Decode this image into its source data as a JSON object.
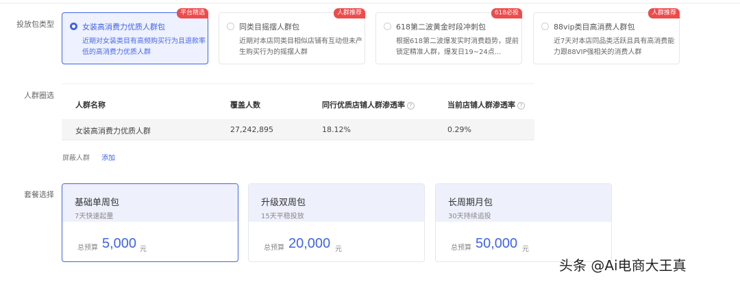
{
  "labels": {
    "package_type": "投放包类型",
    "crowd_select": "人群圈选",
    "plan_select": "套餐选择"
  },
  "packages": [
    {
      "title": "女装高消费力优质人群包",
      "tag": "平台精选",
      "desc": "近期对女装类目有高频购买行为且退款率低的高消费力优质人群"
    },
    {
      "title": "同类目摇摆人群包",
      "tag": "人群推荐",
      "desc": "近期对本店同类目相似店铺有互动但未产生购买行为的摇摆人群"
    },
    {
      "title": "618第二波黄金时段冲刺包",
      "tag": "618必投",
      "desc": "根据618第二波爆发实时消费趋势，提前锁定精准人群，爆发日19~24点..."
    },
    {
      "title": "88vip类目高消费人群包",
      "tag": "人群推荐",
      "desc": "近7天对本店同品类活跃且具有高消费能力跟88VIP强相关的消费人群"
    }
  ],
  "table": {
    "headers": [
      "人群名称",
      "覆盖人数",
      "同行优质店铺人群渗透率",
      "当前店铺人群渗透率"
    ],
    "row": [
      "女装高消费力优质人群",
      "27,242,895",
      "18.12%",
      "0.29%"
    ],
    "help_glyph": "?"
  },
  "shield": {
    "label": "屏蔽人群",
    "add": "添加"
  },
  "plans": [
    {
      "name": "基础单周包",
      "sub": "7天快速起量",
      "budget_label": "总预算",
      "amount": "5,000",
      "unit": "元"
    },
    {
      "name": "升级双周包",
      "sub": "15天平稳投放",
      "budget_label": "总预算",
      "amount": "20,000",
      "unit": "元"
    },
    {
      "name": "长周期月包",
      "sub": "30天持续追投",
      "budget_label": "总预算",
      "amount": "50,000",
      "unit": "元"
    }
  ],
  "watermark": "头条 @Ai电商大王真",
  "colors": {
    "accent": "#3f63e8",
    "tag_red": "#ee4b4b"
  }
}
